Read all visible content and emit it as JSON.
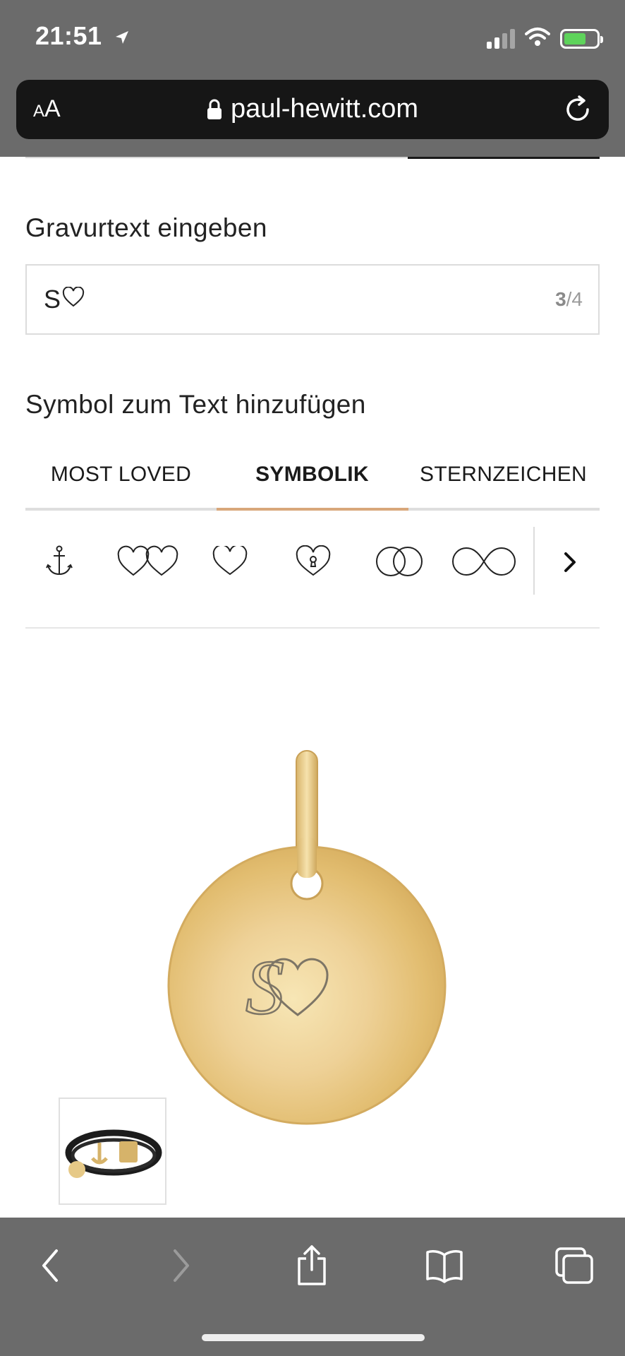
{
  "status_bar": {
    "time": "21:51"
  },
  "url_bar": {
    "text_size_small": "A",
    "text_size_big": "A",
    "url": "paul-hewitt.com"
  },
  "engraving": {
    "label": "Gravurtext eingeben",
    "value": "S",
    "counter_current": "3",
    "counter_max": "/4"
  },
  "symbols": {
    "label": "Symbol zum Text hinzufügen",
    "tabs": [
      {
        "label": "MOST LOVED",
        "active": false
      },
      {
        "label": "SYMBOLIK",
        "active": true
      },
      {
        "label": "STERNZEICHEN",
        "active": false
      }
    ],
    "items": [
      "anchor-icon",
      "double-heart-icon",
      "heart-icon",
      "heart-lock-icon",
      "two-rings-icon",
      "infinity-icon"
    ]
  },
  "preview": {
    "engraved_text": "S",
    "engraved_symbol": "heart-icon"
  },
  "colors": {
    "chrome_gray": "#6b6b6b",
    "active_tab_underline": "#d8a77a",
    "pendant_gold": "#e8c878",
    "battery_green": "#5ed35b"
  }
}
